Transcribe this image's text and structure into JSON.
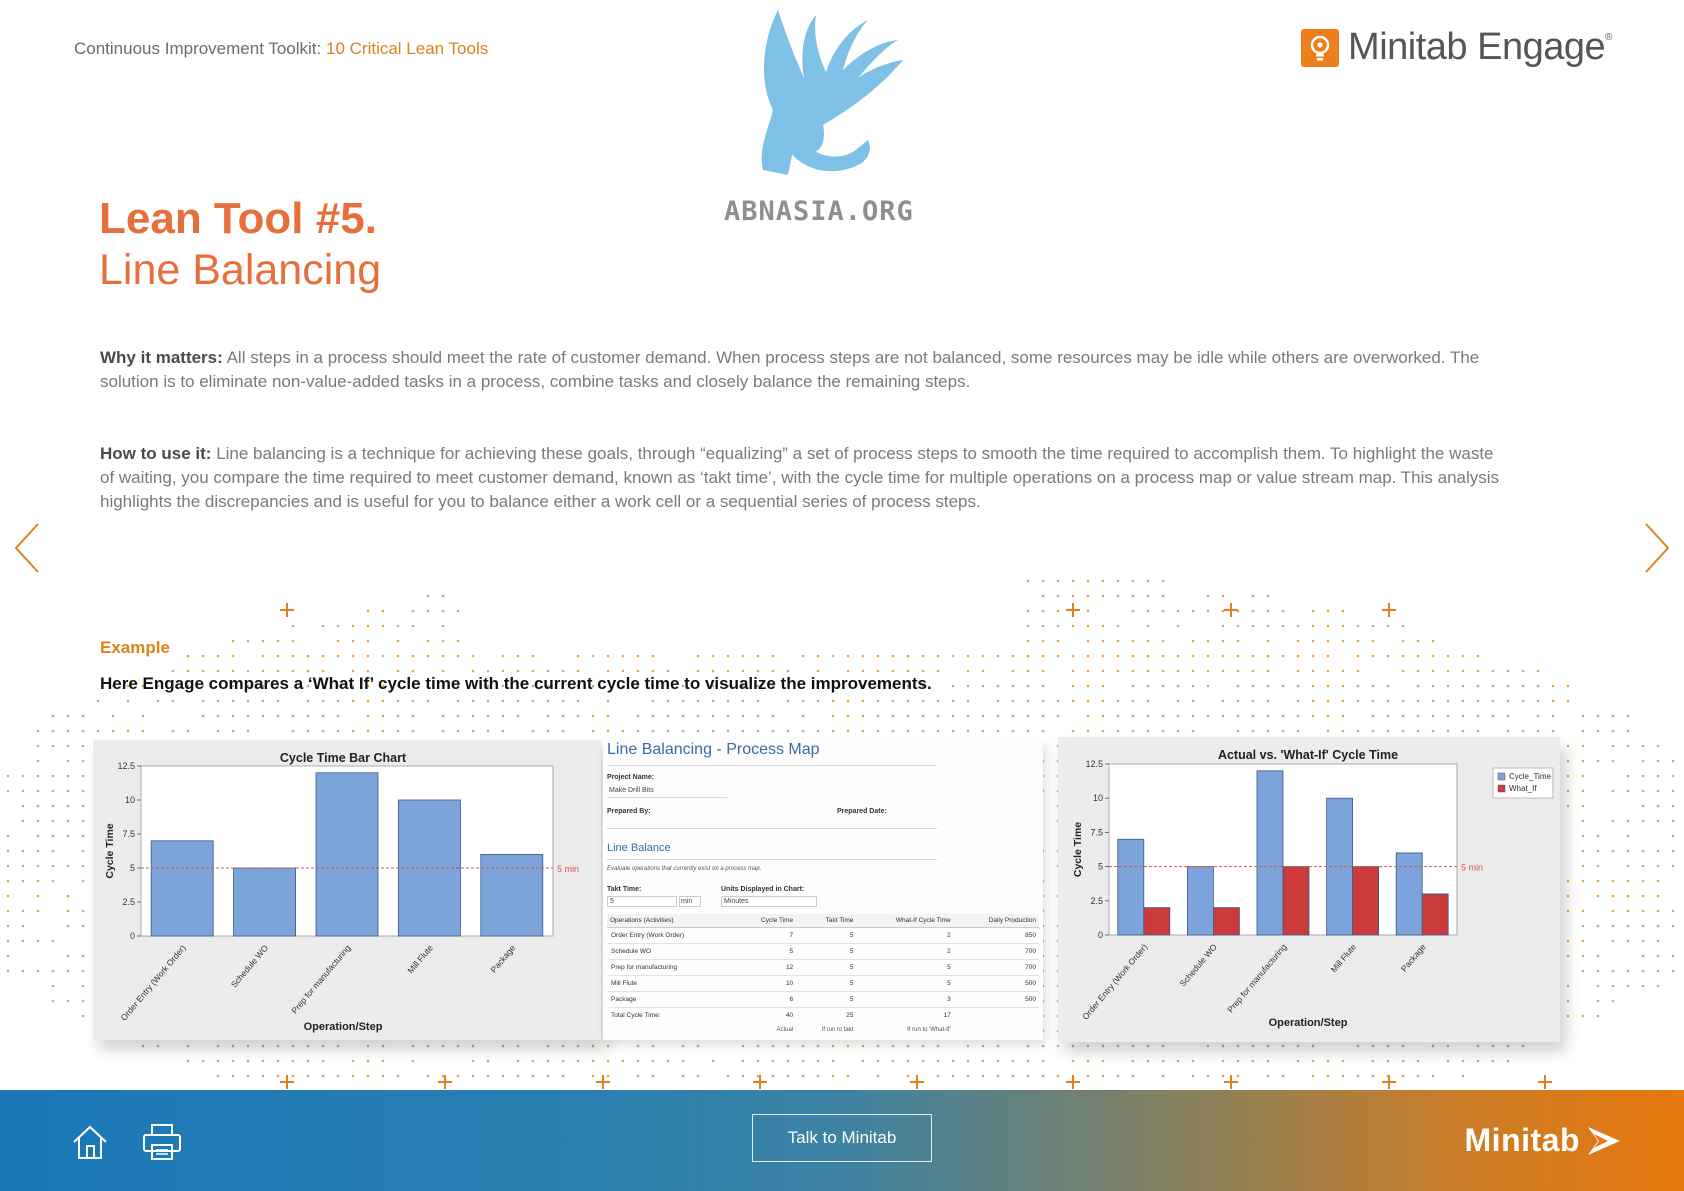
{
  "header": {
    "breadcrumb_prefix": "Continuous Improvement Toolkit:",
    "breadcrumb_link": "10 Critical Lean Tools",
    "brand_name": "Minitab Engage",
    "brand_mark": "®",
    "watermark_text": "ABNASIA.ORG",
    "watermark_icon": "griffin-logo-icon"
  },
  "title": {
    "number": "Lean Tool #5.",
    "name": "Line Balancing"
  },
  "body": {
    "why_label": "Why it matters:",
    "why_text": "All steps in a process should meet the rate of customer demand. When process steps are not balanced, some resources may be idle while others are overworked. The solution is to eliminate non-value-added tasks in a process, combine tasks and closely balance the remaining steps.",
    "how_label": "How to use it:",
    "how_text": "Line balancing is a technique for achieving these goals, through “equalizing” a set of process steps to smooth the time required to accomplish them. To highlight the waste of waiting, you compare the time required to meet customer demand, known as ‘takt time’, with the cycle time for multiple operations on a process map or value stream map. This analysis highlights the discrepancies and is useful for you to balance either a work cell or a sequential series of process steps."
  },
  "example": {
    "label": "Example",
    "description": "Here Engage compares a ‘What If’ cycle time with the current cycle time to visualize the improvements."
  },
  "process_map": {
    "title": "Line Balancing - Process Map",
    "project_name_label": "Project Name:",
    "project_name_value": "Make Drill Bits",
    "prepared_by_label": "Prepared By:",
    "prepared_date_label": "Prepared Date:",
    "section_title": "Line Balance",
    "note": "Evaluate operations that currently exist on a process map.",
    "takt_label": "Takt Time:",
    "takt_value": "5",
    "takt_unit": "min",
    "units_label": "Units Displayed in Chart:",
    "units_value": "Minutes",
    "columns": [
      "Operations (Activities)",
      "Cycle Time",
      "Takt Time",
      "What-If Cycle Time",
      "Daily Production"
    ],
    "rows": [
      [
        "Order Entry (Work Order)",
        "7",
        "5",
        "2",
        "850"
      ],
      [
        "Schedule WO",
        "5",
        "5",
        "2",
        "700"
      ],
      [
        "Prep for manufacturing",
        "12",
        "5",
        "5",
        "700"
      ],
      [
        "Mill Flute",
        "10",
        "5",
        "5",
        "500"
      ],
      [
        "Package",
        "6",
        "5",
        "3",
        "500"
      ]
    ],
    "total_label": "Total Cycle Time:",
    "totals": [
      "40",
      "25",
      "17"
    ],
    "footnotes": [
      "Actual",
      "If run to takt",
      "If run to 'What-If'"
    ]
  },
  "chart_data": [
    {
      "type": "bar",
      "title": "Cycle Time Bar Chart",
      "xlabel": "Operation/Step",
      "ylabel": "Cycle Time",
      "categories": [
        "Order Entry (Work Order)",
        "Schedule WO",
        "Prep for manufacturing",
        "Mill Flute",
        "Package"
      ],
      "values": [
        7,
        5,
        12,
        10,
        6
      ],
      "ylim": [
        0,
        12.5
      ],
      "yticks": [
        "0",
        "2.5",
        "5",
        "7.5",
        "10",
        "12.5"
      ],
      "reference_line": {
        "value": 5,
        "label": "5 min"
      },
      "bar_color": "#7da3db",
      "ref_color": "#d9534f"
    },
    {
      "type": "bar",
      "title": "Actual vs. 'What-If' Cycle Time",
      "xlabel": "Operation/Step",
      "ylabel": "Cycle Time",
      "categories": [
        "Order Entry (Work Order)",
        "Schedule WO",
        "Prep for manufacturing",
        "Mill Flute",
        "Package"
      ],
      "series": [
        {
          "name": "Cycle_Time",
          "values": [
            7,
            5,
            12,
            10,
            6
          ],
          "color": "#7da3db"
        },
        {
          "name": "What_If",
          "values": [
            2,
            2,
            5,
            5,
            3
          ],
          "color": "#cc3b3b"
        }
      ],
      "ylim": [
        0,
        12.5
      ],
      "yticks": [
        "0",
        "2.5",
        "5",
        "7.5",
        "10",
        "12.5"
      ],
      "reference_line": {
        "value": 5,
        "label": "5 min"
      },
      "legend": "top-right",
      "ref_color": "#d9534f"
    }
  ],
  "footer": {
    "talk_button": "Talk to Minitab",
    "brand_name": "Minitab",
    "home_icon": "home-icon",
    "print_icon": "printer-icon"
  },
  "nav": {
    "prev_icon": "chevron-left-icon",
    "next_icon": "chevron-right-icon"
  },
  "colors": {
    "accent_orange": "#e0811e",
    "title_orange": "#e5703c",
    "link_blue": "#3b6aa8"
  }
}
